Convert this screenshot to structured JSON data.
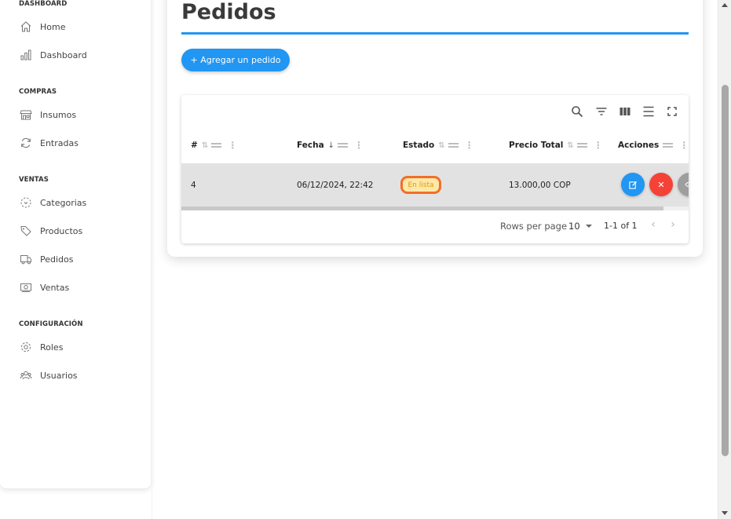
{
  "sidebar": {
    "sections": [
      {
        "title": "DASHBOARD",
        "items": [
          {
            "label": "Home",
            "icon": "home-icon"
          },
          {
            "label": "Dashboard",
            "icon": "bar-chart-icon"
          }
        ]
      },
      {
        "title": "COMPRAS",
        "items": [
          {
            "label": "Insumos",
            "icon": "store-icon"
          },
          {
            "label": "Entradas",
            "icon": "refresh-icon"
          }
        ]
      },
      {
        "title": "VENTAS",
        "items": [
          {
            "label": "Categorias",
            "icon": "category-icon"
          },
          {
            "label": "Productos",
            "icon": "tag-icon"
          },
          {
            "label": "Pedidos",
            "icon": "truck-icon"
          },
          {
            "label": "Ventas",
            "icon": "money-icon"
          }
        ]
      },
      {
        "title": "CONFIGURACIÓN",
        "items": [
          {
            "label": "Roles",
            "icon": "gear-icon"
          },
          {
            "label": "Usuarios",
            "icon": "users-icon"
          }
        ]
      }
    ]
  },
  "page": {
    "title": "Pedidos",
    "add_button": "+ Agregar un pedido"
  },
  "table": {
    "columns": [
      "#",
      "Fecha",
      "Estado",
      "Precio Total",
      "Acciones"
    ],
    "rows": [
      {
        "id": "4",
        "fecha": "06/12/2024, 22:42",
        "estado": "En lista",
        "precio": "13.000,00 COP"
      }
    ],
    "footer": {
      "rows_per_page_label": "Rows per page",
      "rows_per_page_value": "10",
      "range": "1-1 of 1"
    }
  },
  "colors": {
    "accent": "#2196f3",
    "delete": "#f44336",
    "view": "#9e9e9e",
    "badge_border": "#f36e28",
    "badge_bg": "#fde8a8"
  }
}
